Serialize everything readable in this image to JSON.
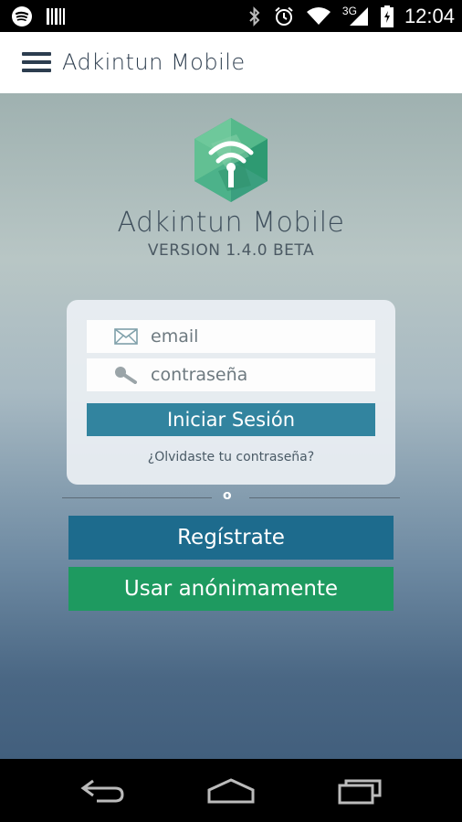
{
  "status_bar": {
    "left_icons": [
      "spotify-icon",
      "barcode-icon"
    ],
    "right_icons": [
      "bluetooth-icon",
      "alarm-icon",
      "wifi-icon",
      "signal-icon",
      "battery-icon"
    ],
    "network_type": "3G",
    "time": "12:04"
  },
  "app_bar": {
    "menu_icon": "hamburger-menu-icon",
    "title": "Adkintun Mobile"
  },
  "brand": {
    "logo_icon": "adkintun-hexagon-logo",
    "name": "Adkintun Mobile",
    "version": "VERSION 1.4.0 BETA"
  },
  "login": {
    "email_placeholder": "email",
    "email_value": "",
    "password_placeholder": "contraseña",
    "password_value": "",
    "submit_label": "Iniciar Sesión",
    "forgot_label": "¿Olvidaste tu contraseña?"
  },
  "divider_label": "o",
  "actions": {
    "register_label": "Regístrate",
    "anonymous_label": "Usar anónimamente"
  },
  "nav_bar": {
    "items": [
      "back-icon",
      "home-icon",
      "recent-apps-icon"
    ]
  },
  "colors": {
    "app_bar_bg": "#ffffff",
    "login_button": "#32849f",
    "register_button": "#1d6b8d",
    "anonymous_button": "#1e9a60",
    "logo_green": "#3fa87a"
  }
}
